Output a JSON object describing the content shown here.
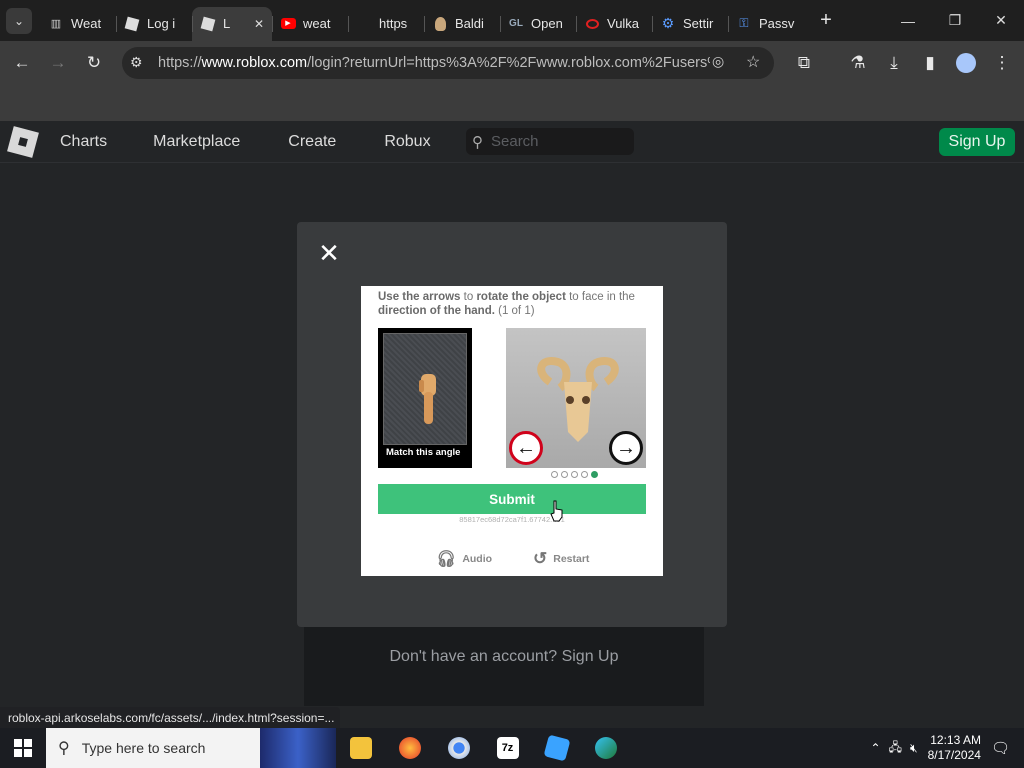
{
  "browser": {
    "tabs": [
      {
        "label": "Weat",
        "icon": "columns-icon"
      },
      {
        "label": "Log i",
        "icon": "roblox-icon"
      },
      {
        "label": "L",
        "icon": "roblox-icon",
        "active": true
      },
      {
        "label": "weat",
        "icon": "youtube-icon"
      },
      {
        "label": "https",
        "icon": "blank-icon"
      },
      {
        "label": "Baldi",
        "icon": "baldi-icon"
      },
      {
        "label": "Open",
        "icon": "opengl-icon"
      },
      {
        "label": "Vulka",
        "icon": "opera-icon"
      },
      {
        "label": "Settir",
        "icon": "gear-icon"
      },
      {
        "label": "Passv",
        "icon": "key-icon"
      }
    ],
    "url_prefix": "https://",
    "url_host": "www.roblox.com",
    "url_rest": "/login?returnUrl=https%3A%2F%2Fwww.roblox.com%2Fusers%..."
  },
  "roblox_nav": {
    "links": [
      "Charts",
      "Marketplace",
      "Create",
      "Robux"
    ],
    "search_placeholder": "Search",
    "signup_label": "Sign Up"
  },
  "captcha": {
    "instr_1": "Use the arrows",
    "instr_2": " to ",
    "instr_3": "rotate the object",
    "instr_4": " to face in the ",
    "instr_5": "direction of the hand.",
    "instr_6": " (1 of 1)",
    "match_label": "Match this angle",
    "submit_label": "Submit",
    "session_id": "85817ec68d72ca7f1.67742...01",
    "audio_label": "Audio",
    "restart_label": "Restart",
    "pages_total": 5,
    "page_current": 5,
    "accent_color": "#3ec27b"
  },
  "page": {
    "no_account_text": "Don't have an account? Sign Up"
  },
  "status_bar": "roblox-api.arkoselabs.com/fc/assets/.../index.html?session=...",
  "taskbar": {
    "search_placeholder": "Type here to search",
    "time": "12:13 AM",
    "date": "8/17/2024"
  }
}
